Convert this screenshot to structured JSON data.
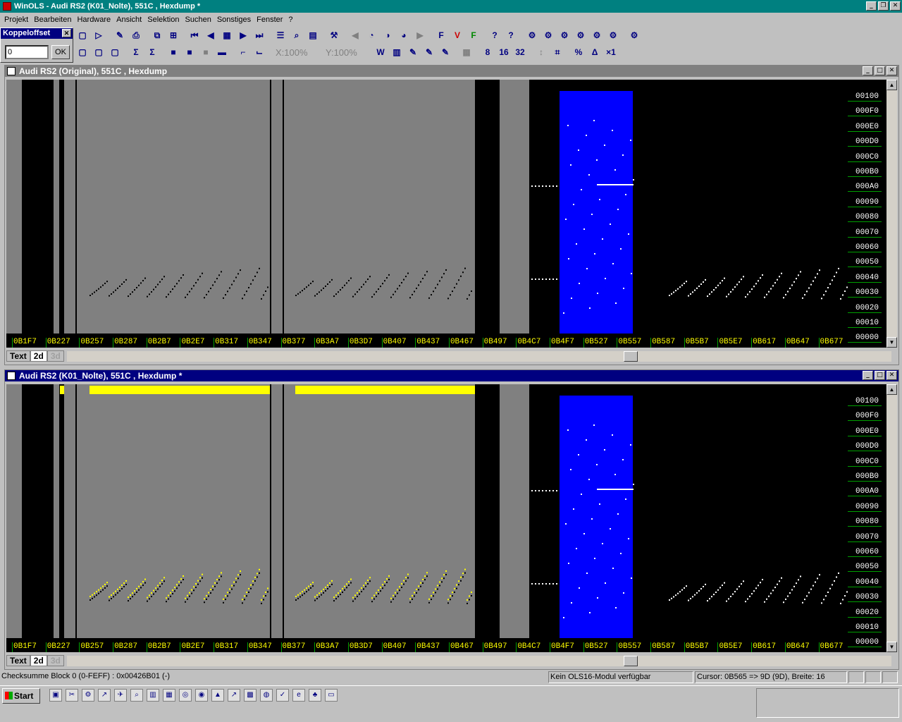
{
  "app": {
    "title": "WinOLS - Audi RS2 (K01_Nolte), 551C , Hexdump *"
  },
  "menu": [
    "Projekt",
    "Bearbeiten",
    "Hardware",
    "Ansicht",
    "Selektion",
    "Suchen",
    "Sonstiges",
    "Fenster",
    "?"
  ],
  "koppel": {
    "title": "Koppeloffset",
    "value": "0",
    "ok": "OK"
  },
  "zoom": {
    "x": "X:100%",
    "y": "Y:100%"
  },
  "windows": [
    {
      "title": "Audi RS2 (Original), 551C , Hexdump",
      "active": false
    },
    {
      "title": "Audi RS2 (K01_Nolte), 551C , Hexdump *",
      "active": true
    }
  ],
  "yaxis": [
    "00100",
    "000F0",
    "000E0",
    "000D0",
    "000C0",
    "000B0",
    "000A0",
    "00090",
    "00080",
    "00070",
    "00060",
    "00050",
    "00040",
    "00030",
    "00020",
    "00010",
    "00000"
  ],
  "xaxis": [
    "0B1F7",
    "0B227",
    "0B257",
    "0B287",
    "0B2B7",
    "0B2E7",
    "0B317",
    "0B347",
    "0B377",
    "0B3A7",
    "0B3D7",
    "0B407",
    "0B437",
    "0B467",
    "0B497",
    "0B4C7",
    "0B4F7",
    "0B527",
    "0B557",
    "0B587",
    "0B5B7",
    "0B5E7",
    "0B617",
    "0B647",
    "0B677"
  ],
  "tabs": [
    "Text",
    "2d",
    "3d"
  ],
  "status": {
    "checksum": "Checksumme Block 0 (0-FEFF) : 0x00426B01 (-)",
    "module": "Kein OLS16-Modul verfügbar",
    "cursor": "Cursor: 0B565 => 9D (9D), Breite: 16"
  },
  "taskbar": {
    "start": "Start"
  }
}
